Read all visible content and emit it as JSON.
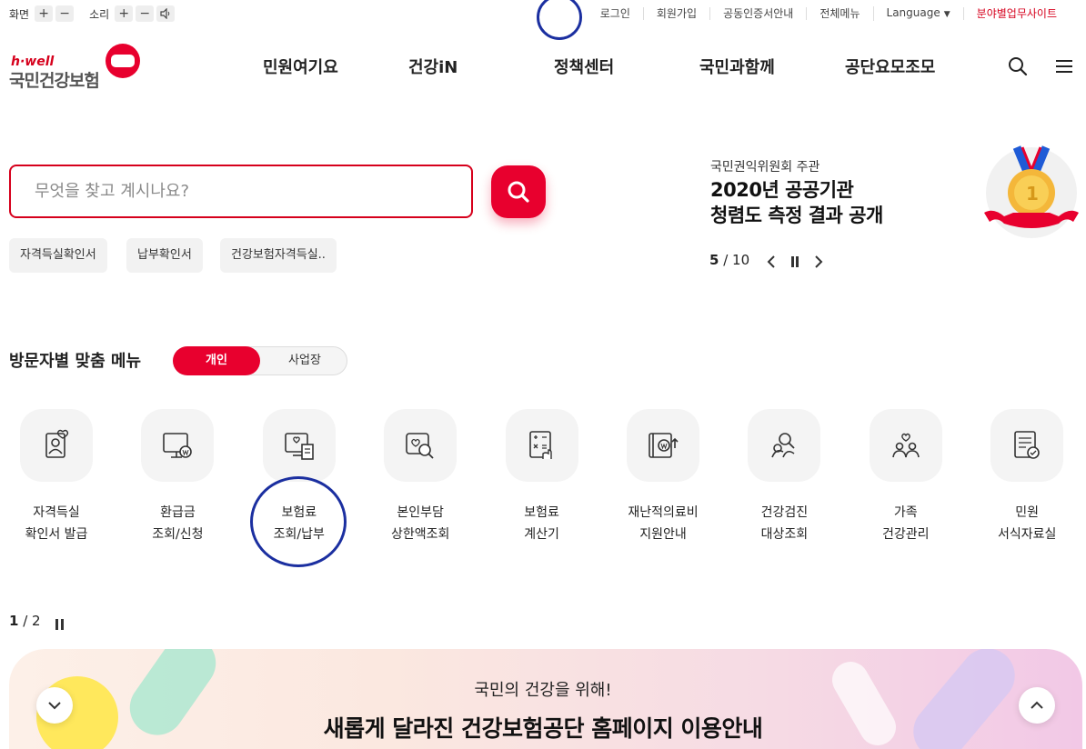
{
  "util": {
    "screen_label": "화면",
    "sound_label": "소리",
    "plus": "+",
    "minus": "−",
    "links": [
      "로그인",
      "회원가입",
      "공동인증서안내",
      "전체메뉴",
      "Language"
    ],
    "field_site": "분야별업무사이트"
  },
  "logo": {
    "tagline": "h·well",
    "name": "국민건강보험"
  },
  "gnb": [
    "민원여기요",
    "건강iN",
    "정책센터",
    "국민과함께",
    "공단요모조모"
  ],
  "search": {
    "placeholder": "무엇을 찾고 계시나요?",
    "chips": [
      "자격득실확인서",
      "납부확인서",
      "건강보험자격득실.."
    ]
  },
  "banner": {
    "sub": "국민권익위원회 주관",
    "title_line1": "2020년 공공기관",
    "title_line2": "청렴도 측정 결과 공개",
    "current": "5",
    "total": "/ 10"
  },
  "visitor_menu": {
    "title": "방문자별 맞춤 메뉴",
    "tab_individual": "개인",
    "tab_business": "사업장",
    "services": [
      {
        "line1": "자격득실",
        "line2": "확인서 발급",
        "icon": "person-card-icon"
      },
      {
        "line1": "환급금",
        "line2": "조회/신청",
        "icon": "monitor-won-icon"
      },
      {
        "line1": "보험료",
        "line2": "조회/납부",
        "icon": "bill-receipt-icon"
      },
      {
        "line1": "본인부담",
        "line2": "상한액조회",
        "icon": "heart-search-icon"
      },
      {
        "line1": "보험료",
        "line2": "계산기",
        "icon": "calculator-icon"
      },
      {
        "line1": "재난적의료비",
        "line2": "지원안내",
        "icon": "wallet-won-icon"
      },
      {
        "line1": "건강검진",
        "line2": "대상조회",
        "icon": "people-search-icon"
      },
      {
        "line1": "가족",
        "line2": "건강관리",
        "icon": "family-heart-icon"
      },
      {
        "line1": "민원",
        "line2": "서식자료실",
        "icon": "document-check-icon"
      }
    ],
    "page_current": "1",
    "page_total": "/ 2"
  },
  "promo": {
    "sub": "국민의 건강을 위해!",
    "title": "새롭게 달라진 건강보험공단 홈페이지 이용안내"
  },
  "colors": {
    "brand_red": "#e8002e",
    "annotation_blue": "#1b2fa0"
  }
}
